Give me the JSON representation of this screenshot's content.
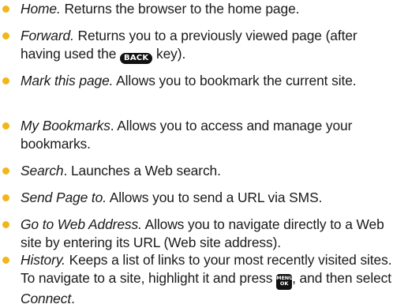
{
  "items": [
    {
      "term": "Home.",
      "desc": " Returns the browser to the home page."
    },
    {
      "term": "Forward.",
      "desc_before": " Returns you to a previously viewed page (after having used the ",
      "key": "BACK",
      "desc_after": " key)."
    },
    {
      "term": "Mark this page.",
      "desc": " Allows you to bookmark the current site."
    },
    {
      "term": "My Bookmarks",
      "sep": ".",
      "desc": " Allows you to access and manage your bookmarks."
    },
    {
      "term": "Search",
      "sep": ".",
      "desc": " Launches a Web search."
    },
    {
      "term": "Send Page to.",
      "desc": " Allows you to send a URL via SMS."
    },
    {
      "term": "Go to Web Address.",
      "desc": " Allows you to navigate directly to a Web site by entering its URL (Web site address)."
    },
    {
      "term": "History.",
      "desc_before": " Keeps a list of links to your most recently visited sites. To navigate to a site, highlight it and press ",
      "key_top": "MENU",
      "key_bottom": "OK",
      "desc_after": ", and then select ",
      "action": "Connect",
      "end": "."
    }
  ],
  "colors": {
    "bullet": "#f2b61b",
    "text": "#1a1a1a",
    "key_bg": "#111111"
  }
}
